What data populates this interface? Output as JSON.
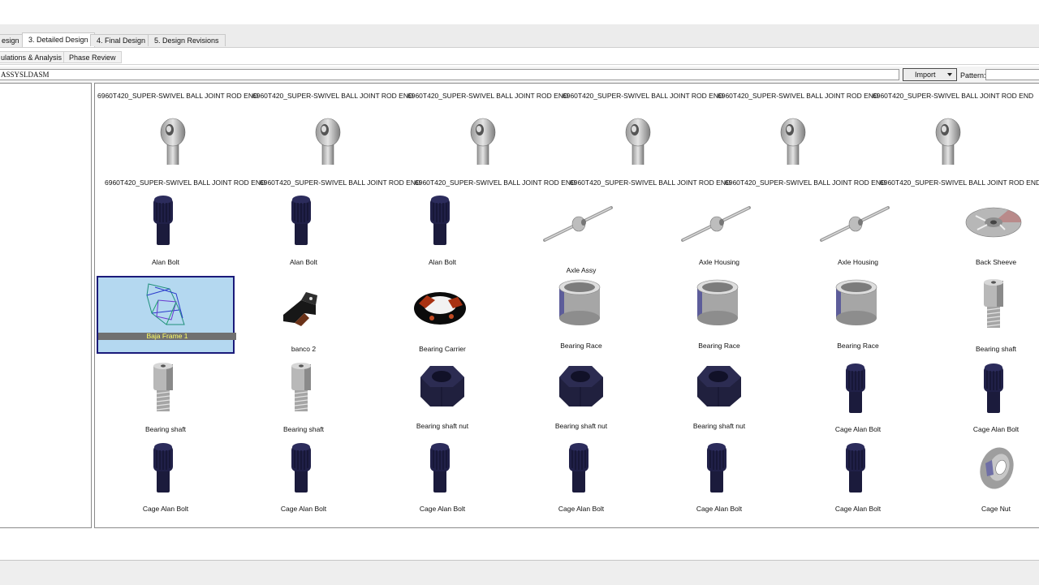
{
  "tabs": [
    {
      "label": "esign",
      "active": false
    },
    {
      "label": "3. Detailed Design",
      "active": true
    },
    {
      "label": "4. Final Design",
      "active": false
    },
    {
      "label": "5. Design Revisions",
      "active": false
    }
  ],
  "subtabs": [
    {
      "label": "ulations & Analysis"
    },
    {
      "label": "Phase Review"
    }
  ],
  "toolbar": {
    "path_value": "ASSYSLDASM",
    "import_label": "Import",
    "pattern_label": "Pattern:",
    "pattern_value": ""
  },
  "grid": {
    "header_row": [
      "6960T420_SUPER-SWIVEL BALL JOINT ROD END",
      "6960T420_SUPER-SWIVEL BALL JOINT ROD END",
      "6960T420_SUPER-SWIVEL BALL JOINT ROD END",
      "6960T420_SUPER-SWIVEL BALL JOINT ROD END",
      "6960T420_SUPER-SWIVEL BALL JOINT ROD END",
      "6960T420_SUPER-SWIVEL BALL JOINT ROD END"
    ],
    "row1": [
      {
        "label": "6960T420_SUPER-SWIVEL BALL JOINT ROD END",
        "icon": "rod-end"
      },
      {
        "label": "6960T420_SUPER-SWIVEL BALL JOINT ROD END",
        "icon": "rod-end"
      },
      {
        "label": "6960T420_SUPER-SWIVEL BALL JOINT ROD END",
        "icon": "rod-end"
      },
      {
        "label": "6960T420_SUPER-SWIVEL BALL JOINT ROD END",
        "icon": "rod-end"
      },
      {
        "label": "6960T420_SUPER-SWIVEL BALL JOINT ROD END",
        "icon": "rod-end"
      },
      {
        "label": "6960T420_SUPER-SWIVEL BALL JOINT ROD END",
        "icon": "rod-end"
      }
    ],
    "row2": [
      {
        "label": "Alan Bolt",
        "icon": "cap-bolt"
      },
      {
        "label": "Alan Bolt",
        "icon": "cap-bolt"
      },
      {
        "label": "Alan Bolt",
        "icon": "cap-bolt"
      },
      {
        "label": "Axle Assy",
        "icon": "axle"
      },
      {
        "label": "Axle Housing",
        "icon": "axle"
      },
      {
        "label": "Axle Housing",
        "icon": "axle"
      },
      {
        "label": "Back Sheeve",
        "icon": "sheave"
      }
    ],
    "row3": [
      {
        "label": "Baja Frame 1",
        "icon": "frame",
        "selected": true
      },
      {
        "label": "banco 2",
        "icon": "bracket"
      },
      {
        "label": "Bearing Carrier",
        "icon": "carrier"
      },
      {
        "label": "Bearing Race",
        "icon": "race"
      },
      {
        "label": "Bearing Race",
        "icon": "race"
      },
      {
        "label": "Bearing Race",
        "icon": "race"
      },
      {
        "label": "Bearing shaft",
        "icon": "shaft"
      }
    ],
    "row4": [
      {
        "label": "Bearing shaft",
        "icon": "shaft"
      },
      {
        "label": "Bearing shaft",
        "icon": "shaft"
      },
      {
        "label": "Bearing shaft nut",
        "icon": "hex-nut"
      },
      {
        "label": "Bearing shaft nut",
        "icon": "hex-nut"
      },
      {
        "label": "Bearing shaft nut",
        "icon": "hex-nut"
      },
      {
        "label": "Cage Alan Bolt",
        "icon": "cap-bolt"
      },
      {
        "label": "Cage Alan Bolt",
        "icon": "cap-bolt"
      }
    ],
    "row5": [
      {
        "label": "Cage Alan Bolt",
        "icon": "cap-bolt"
      },
      {
        "label": "Cage Alan Bolt",
        "icon": "cap-bolt"
      },
      {
        "label": "Cage Alan Bolt",
        "icon": "cap-bolt"
      },
      {
        "label": "Cage Alan Bolt",
        "icon": "cap-bolt"
      },
      {
        "label": "Cage Alan Bolt",
        "icon": "cap-bolt"
      },
      {
        "label": "Cage Alan Bolt",
        "icon": "cap-bolt"
      },
      {
        "label": "Cage Nut",
        "icon": "flange-nut"
      }
    ]
  }
}
